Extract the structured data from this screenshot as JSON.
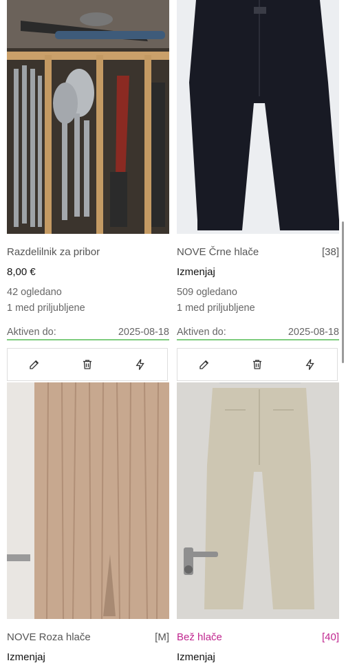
{
  "items": [
    {
      "title": "Razdelilnik za pribor",
      "size": "",
      "price": "8,00 €",
      "views": "42 ogledano",
      "favorites": "1 med priljubljene",
      "active_label": "Aktiven do:",
      "active_date": "2025-08-18"
    },
    {
      "title": "NOVE Črne hlače",
      "size": "[38]",
      "price": "Izmenjaj",
      "views": "509 ogledano",
      "favorites": "1 med priljubljene",
      "active_label": "Aktiven do:",
      "active_date": "2025-08-18"
    },
    {
      "title": "NOVE Roza hlače",
      "size": "[M]",
      "price": "Izmenjaj"
    },
    {
      "title": "Bež hlače",
      "size": "[40]",
      "price": "Izmenjaj"
    }
  ],
  "actions": {
    "edit_icon": "pencil-icon",
    "delete_icon": "trash-icon",
    "promote_icon": "lightning-icon"
  },
  "colors": {
    "accent_pink": "#c0268f",
    "active_underline": "#7dcc7d"
  }
}
